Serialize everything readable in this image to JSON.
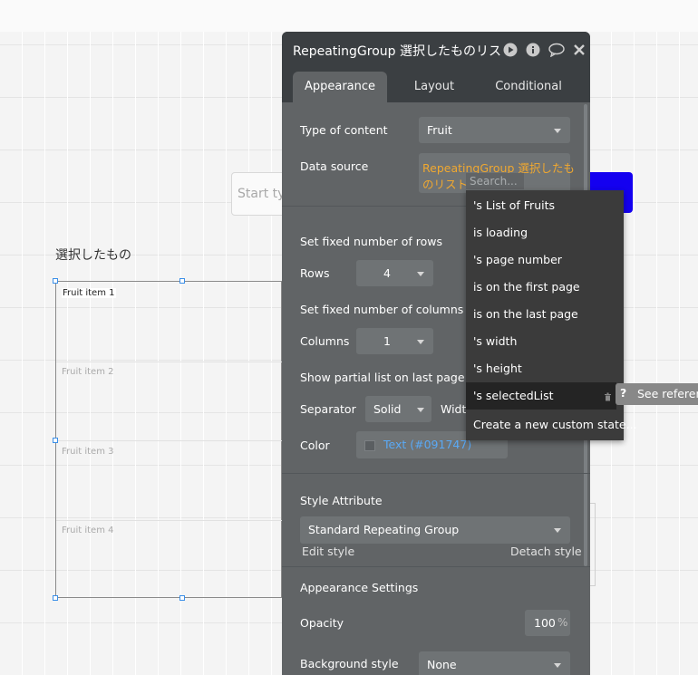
{
  "canvas": {
    "input_placeholder": "Start typ",
    "group_title": "選択したもの",
    "rg_items": [
      "Fruit item 1",
      "Fruit item 2",
      "Fruit item 3",
      "Fruit item 4"
    ]
  },
  "panel": {
    "title": "RepeatingGroup 選択したものリス",
    "tabs": [
      "Appearance",
      "Layout",
      "Conditional"
    ],
    "active_tab": "Appearance",
    "type_of_content_label": "Type of content",
    "type_of_content_value": "Fruit",
    "data_source_label": "Data source",
    "data_source_value_line1": "RepeatingGroup 選択したも",
    "data_source_value_line2": "のリスト",
    "data_source_search_placeholder": "Search...",
    "fixed_rows_label": "Set fixed number of rows",
    "rows_label": "Rows",
    "rows_value": "4",
    "fixed_columns_label": "Set fixed number of columns",
    "columns_label": "Columns",
    "columns_value": "1",
    "partial_list_label": "Show partial list on last page if ne",
    "separator_label": "Separator",
    "separator_value": "Solid",
    "width_label": "Widtl",
    "color_label": "Color",
    "color_value": "Text (#091747)",
    "style_attribute_label": "Style Attribute",
    "style_value": "Standard Repeating Group",
    "edit_style": "Edit style",
    "detach_style": "Detach style",
    "appearance_settings_label": "Appearance Settings",
    "opacity_label": "Opacity",
    "opacity_value": "100",
    "opacity_unit": "%",
    "background_style_label": "Background style",
    "background_style_value": "None"
  },
  "dropdown": {
    "items": [
      "'s List of Fruits",
      " is loading",
      "'s page number",
      " is on the first page",
      " is on the last page",
      "'s width",
      "'s height",
      "'s selectedList",
      "Create a new custom state..."
    ],
    "highlighted_index": 7
  },
  "tooltip": {
    "icon": "?",
    "text": "See referenc"
  },
  "colors": {
    "panel_bg": "#616466",
    "panel_header": "#3b3f42",
    "data_source_text": "#f0a830",
    "link_blue": "#5aa9f5",
    "primary_button": "#1400f0"
  }
}
